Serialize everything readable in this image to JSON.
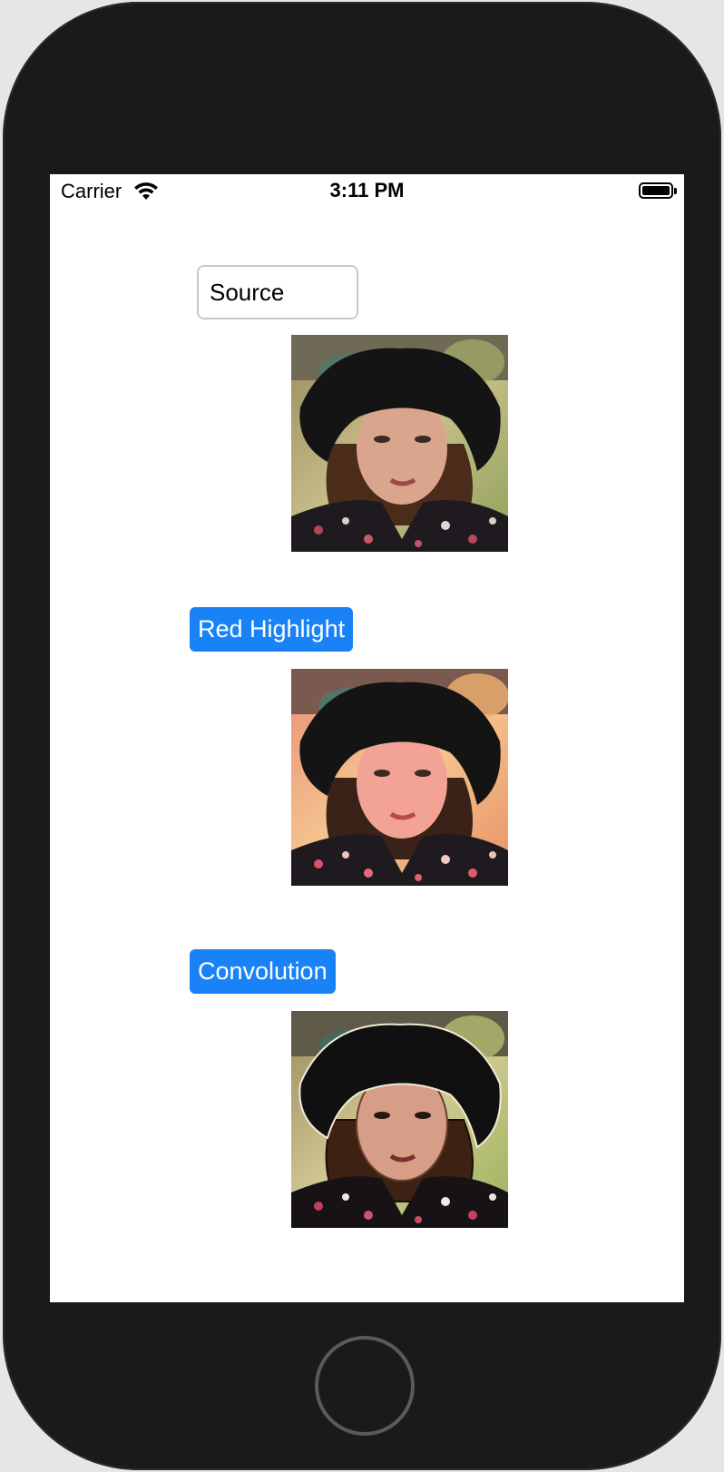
{
  "status_bar": {
    "carrier": "Carrier",
    "time": "3:11 PM",
    "wifi_icon": "wifi-icon",
    "battery_icon": "battery-full-icon"
  },
  "source_field": {
    "value": "Source"
  },
  "buttons": {
    "red_highlight": "Red Highlight",
    "convolution": "Convolution"
  },
  "images": {
    "source": "portrait-photo",
    "red_highlight": "portrait-photo-red-highlight",
    "convolution": "portrait-photo-convolution"
  },
  "colors": {
    "button_blue": "#1a82f7",
    "device_body": "#1a1a1a",
    "screen_bg": "#ffffff"
  }
}
